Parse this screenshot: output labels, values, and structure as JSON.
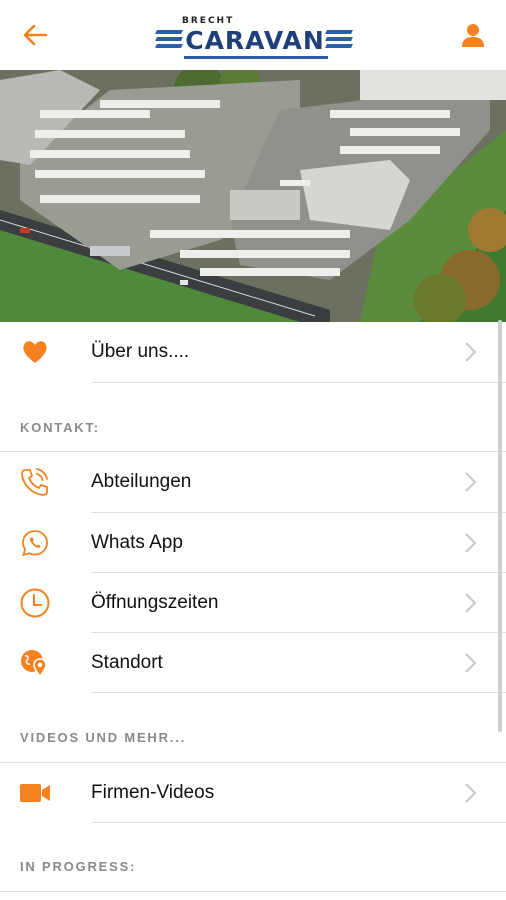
{
  "header": {
    "brand_top": "BRECHT",
    "brand_left": "CARA",
    "brand_right": "VAN"
  },
  "hero": {
    "icon": "aerial-photo"
  },
  "menu": {
    "about": {
      "label": "Über uns...."
    },
    "contact_section": "KONTAKT:",
    "departments": {
      "label": "Abteilungen"
    },
    "whatsapp": {
      "label": "Whats App"
    },
    "hours": {
      "label": "Öffnungszeiten"
    },
    "location": {
      "label": "Standort"
    },
    "videos_section": "VIDEOS UND MEHR...",
    "company_videos": {
      "label": "Firmen-Videos"
    },
    "progress_section": "IN PROGRESS:"
  },
  "colors": {
    "accent": "#f5821f",
    "brand_blue": "#1f3f7a",
    "separator": "#e0e0e0",
    "section_text": "#8a8a8a"
  }
}
